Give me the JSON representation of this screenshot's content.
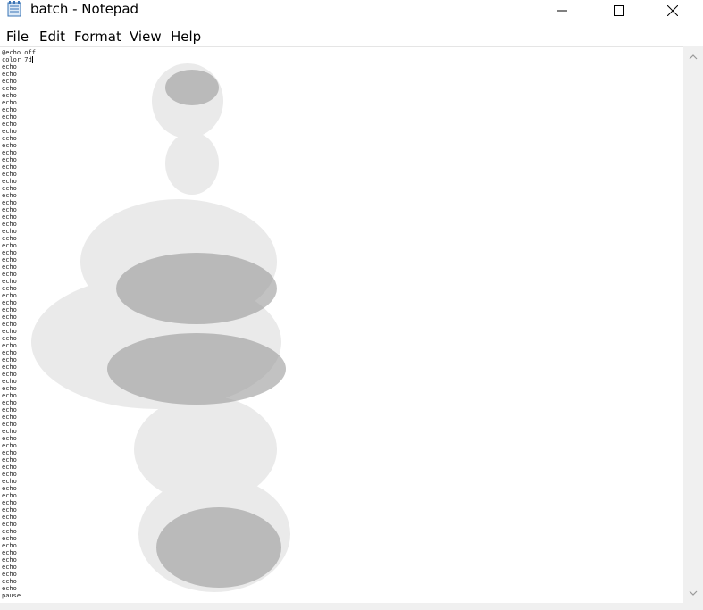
{
  "window": {
    "title": "batch - Notepad"
  },
  "menu": {
    "file": "File",
    "edit": "Edit",
    "format": "Format",
    "view": "View",
    "help": "Help"
  },
  "editor": {
    "line1": "@echo off",
    "line2": "color 7d",
    "echo_token": "echo",
    "echo_line_count": 74,
    "last_line": "pause"
  }
}
